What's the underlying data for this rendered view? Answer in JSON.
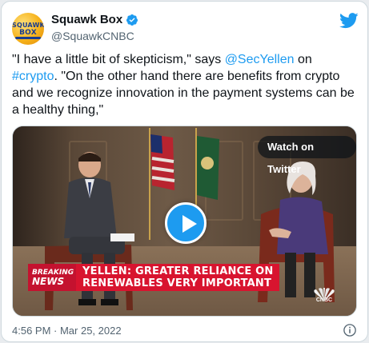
{
  "account": {
    "display_name": "Squawk Box",
    "handle": "@SquawkCNBC",
    "avatar_text_line1": "SQUAWK",
    "avatar_text_line2": "BOX"
  },
  "tweet": {
    "part1": "\"I have a little bit of skepticism,\" says ",
    "mention": "@SecYellen",
    "part2": " on ",
    "hashtag": "#crypto",
    "part3": ". \"On the other hand there are benefits from crypto and we recognize innovation in the payment systems can be a healthy thing,\""
  },
  "media": {
    "watch_label": "Watch on Twitter",
    "breaking_line1": "BREAKING",
    "breaking_line2": "NEWS",
    "headline_line1": "YELLEN: GREATER RELIANCE ON",
    "headline_line2": "RENEWABLES VERY IMPORTANT",
    "network_logo_text": "CNBC"
  },
  "timestamp": "4:56 PM · Mar 25, 2022",
  "icons": {
    "verified": "verified-badge-icon",
    "brand": "twitter-bird-icon",
    "play": "play-icon",
    "info": "info-icon"
  },
  "colors": {
    "accent": "#1d9bf0",
    "text": "#0f1419",
    "muted": "#536471",
    "breaking_red": "#c4122f"
  }
}
